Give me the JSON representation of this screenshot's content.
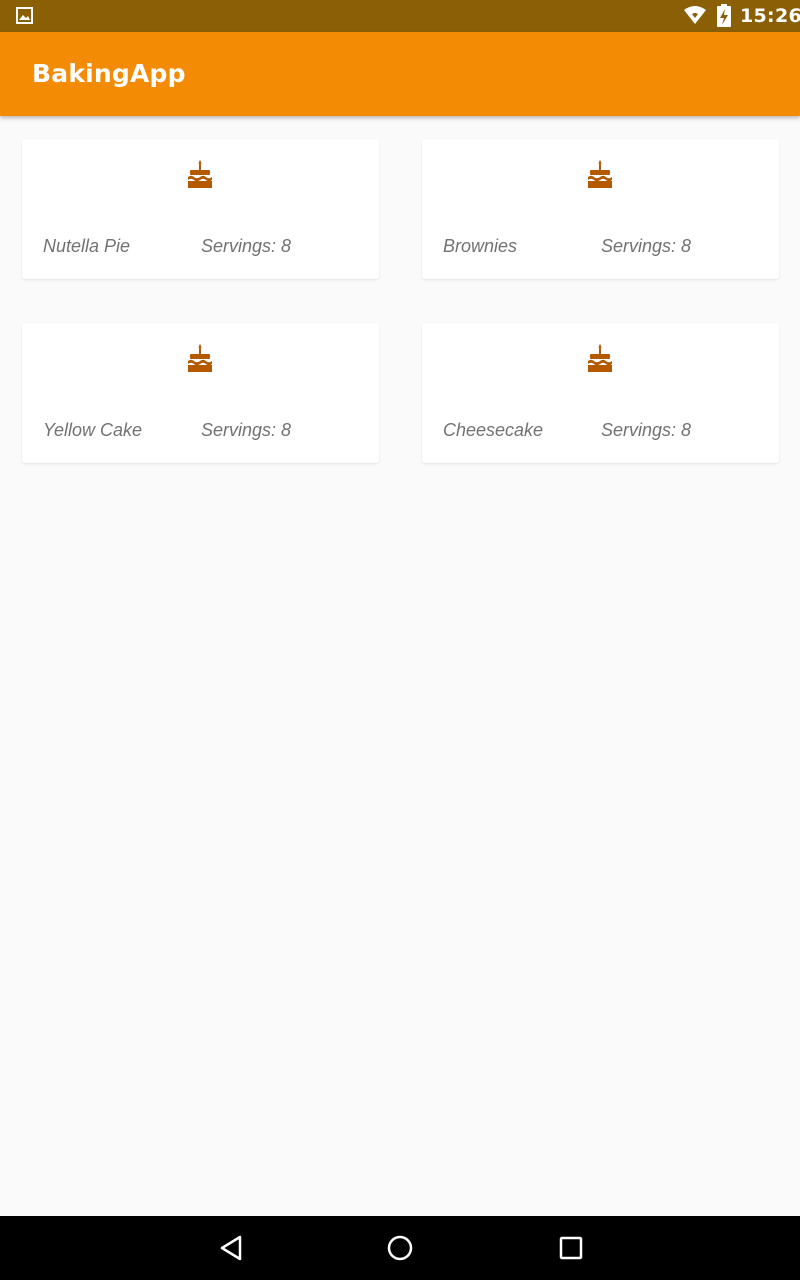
{
  "status_bar": {
    "time": "15:26",
    "icons": [
      "gallery-icon",
      "wifi-icon",
      "battery-charging-icon"
    ]
  },
  "app_bar": {
    "title": "BakingApp"
  },
  "recipes": [
    {
      "name": "Nutella Pie",
      "servings": "Servings: 8",
      "icon": "cake-icon"
    },
    {
      "name": "Brownies",
      "servings": "Servings: 8",
      "icon": "cake-icon"
    },
    {
      "name": "Yellow Cake",
      "servings": "Servings: 8",
      "icon": "cake-icon"
    },
    {
      "name": "Cheesecake",
      "servings": "Servings: 8",
      "icon": "cake-icon"
    }
  ],
  "nav_bar": {
    "buttons": [
      "back-icon",
      "home-icon",
      "recents-icon"
    ]
  },
  "colors": {
    "status_bar": "#8a5f06",
    "app_bar": "#f38b04",
    "cake_icon": "#b35a00",
    "background": "#fafafa"
  }
}
